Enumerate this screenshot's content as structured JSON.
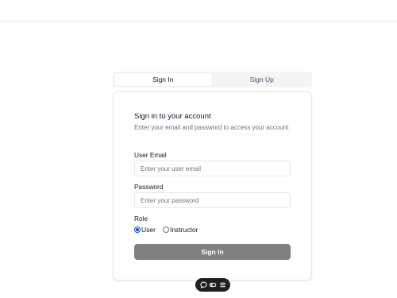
{
  "tabs": [
    {
      "label": "Sign In",
      "active": true
    },
    {
      "label": "Sign Up",
      "active": false
    }
  ],
  "card": {
    "title": "Sign in to your account",
    "subtitle": "Enter your email and password to access your account",
    "email": {
      "label": "User Email",
      "placeholder": "Enter your user email",
      "value": ""
    },
    "password": {
      "label": "Password",
      "placeholder": "Enter your password",
      "value": ""
    },
    "role": {
      "label": "Role",
      "options": [
        {
          "label": "User",
          "checked": true
        },
        {
          "label": "Instructor",
          "checked": false
        }
      ]
    },
    "submit_label": "Sign In"
  },
  "toolbar": {
    "icons": [
      "chat-bubble-icon",
      "toggle-icon",
      "menu-icon"
    ]
  },
  "colors": {
    "button_bg": "#808080",
    "radio_accent": "#1d4ed8",
    "toolbar_bg": "#1f1f1f"
  }
}
